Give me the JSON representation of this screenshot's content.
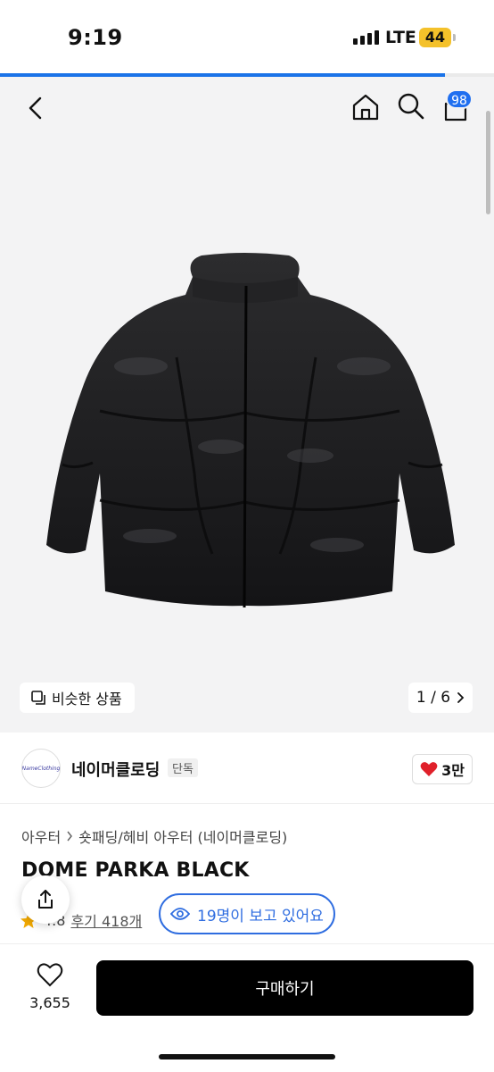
{
  "status_bar": {
    "time": "9:19",
    "network": "LTE",
    "battery": "44"
  },
  "page_load_progress": 0.9,
  "nav": {
    "cart_count": "98"
  },
  "gallery": {
    "similar_label": "비슷한 상품",
    "counter": "1 / 6"
  },
  "brand": {
    "logo_text": "NameClothing",
    "name": "네이머클로딩",
    "tag": "단독",
    "likes": "3만"
  },
  "product": {
    "breadcrumb": [
      "아우터",
      "숏패딩/헤비 아우터 (네이머클로딩)"
    ],
    "title": "DOME PARKA BLACK",
    "rating": "4.8",
    "reviews": "후기 418개",
    "viewers": "19명이 보고 있어요"
  },
  "bottom_bar": {
    "wish_count": "3,655",
    "buy_label": "구매하기"
  },
  "colors": {
    "accent": "#2f6de0",
    "badge": "#1f6ff0",
    "heart": "#e0202a",
    "star": "#f2a900",
    "battery": "#f4c12a"
  },
  "icons": [
    "back-icon",
    "home-icon",
    "search-icon",
    "cart-icon",
    "similar-icon",
    "chevron-right-icon",
    "heart-icon",
    "eye-icon",
    "share-icon",
    "star-icon",
    "wishlist-heart-icon"
  ]
}
